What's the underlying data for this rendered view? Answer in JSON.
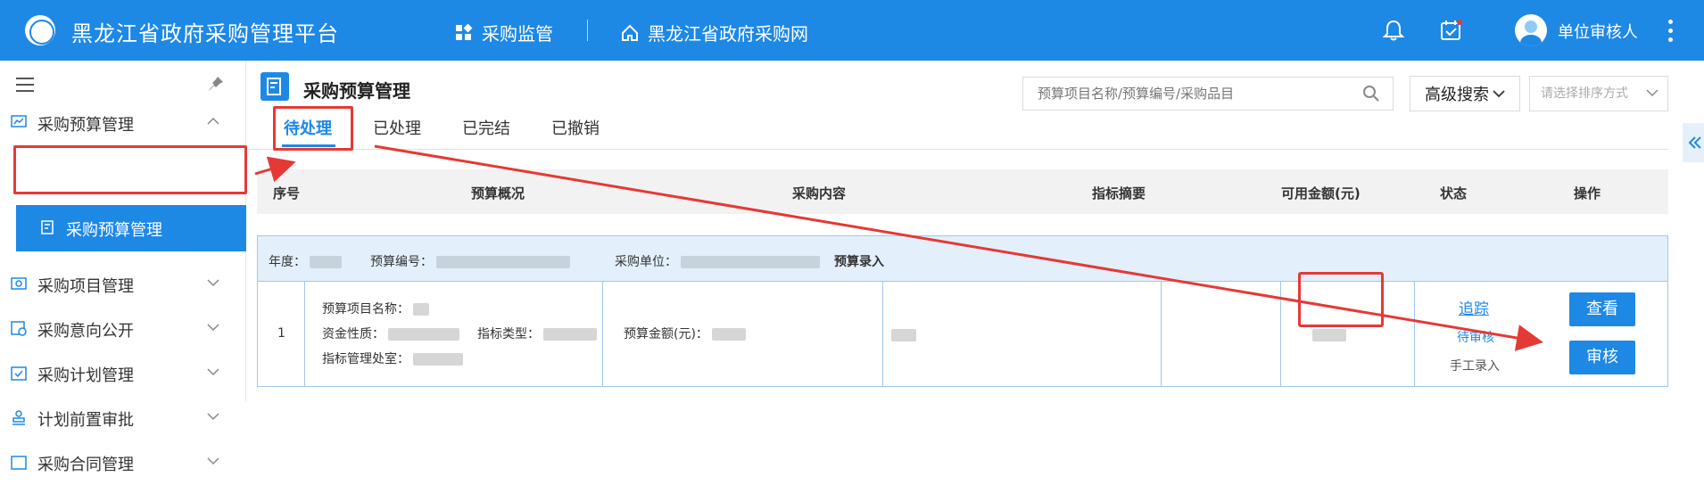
{
  "app": {
    "title": "黑龙江省政府采购管理平台"
  },
  "topnav": {
    "items": [
      {
        "label": "采购监管",
        "icon": "grid-icon"
      },
      {
        "label": "黑龙江省政府采购网",
        "icon": "home-icon"
      }
    ],
    "user_name": "单位审核人"
  },
  "sidebar": {
    "items": [
      {
        "label": "采购预算管理",
        "expanded": true
      },
      {
        "label": "采购预算管理",
        "active": true
      },
      {
        "label": "采购项目管理"
      },
      {
        "label": "采购意向公开"
      },
      {
        "label": "采购计划管理"
      },
      {
        "label": "计划前置审批"
      },
      {
        "label": "采购合同管理"
      }
    ]
  },
  "page": {
    "title": "采购预算管理",
    "search_placeholder": "预算项目名称/预算编号/采购品目",
    "advanced_search": "高级搜索",
    "sort_placeholder": "请选择排序方式"
  },
  "tabs": [
    {
      "label": "待处理",
      "active": true
    },
    {
      "label": "已处理"
    },
    {
      "label": "已完结"
    },
    {
      "label": "已撤销"
    }
  ],
  "table": {
    "headers": [
      "序号",
      "预算概况",
      "采购内容",
      "指标摘要",
      "可用金额(元)",
      "状态",
      "操作"
    ],
    "group": {
      "year_label": "年度：",
      "budget_no_label": "预算编号：",
      "unit_label": "采购单位：",
      "entry_type": "预算录入"
    },
    "row": {
      "index": "1",
      "project_name_label": "预算项目名称：",
      "fund_nature_label": "资金性质：",
      "indicator_type_label": "指标类型：",
      "indicator_office_label": "指标管理处室：",
      "budget_amount_label": "预算金额(元)：",
      "track_link": "追踪",
      "status": "待审核",
      "entry_mode": "手工录入",
      "view_button": "查看",
      "review_button": "审核"
    }
  },
  "colors": {
    "primary": "#1e88e5",
    "highlight": "#e53935"
  }
}
